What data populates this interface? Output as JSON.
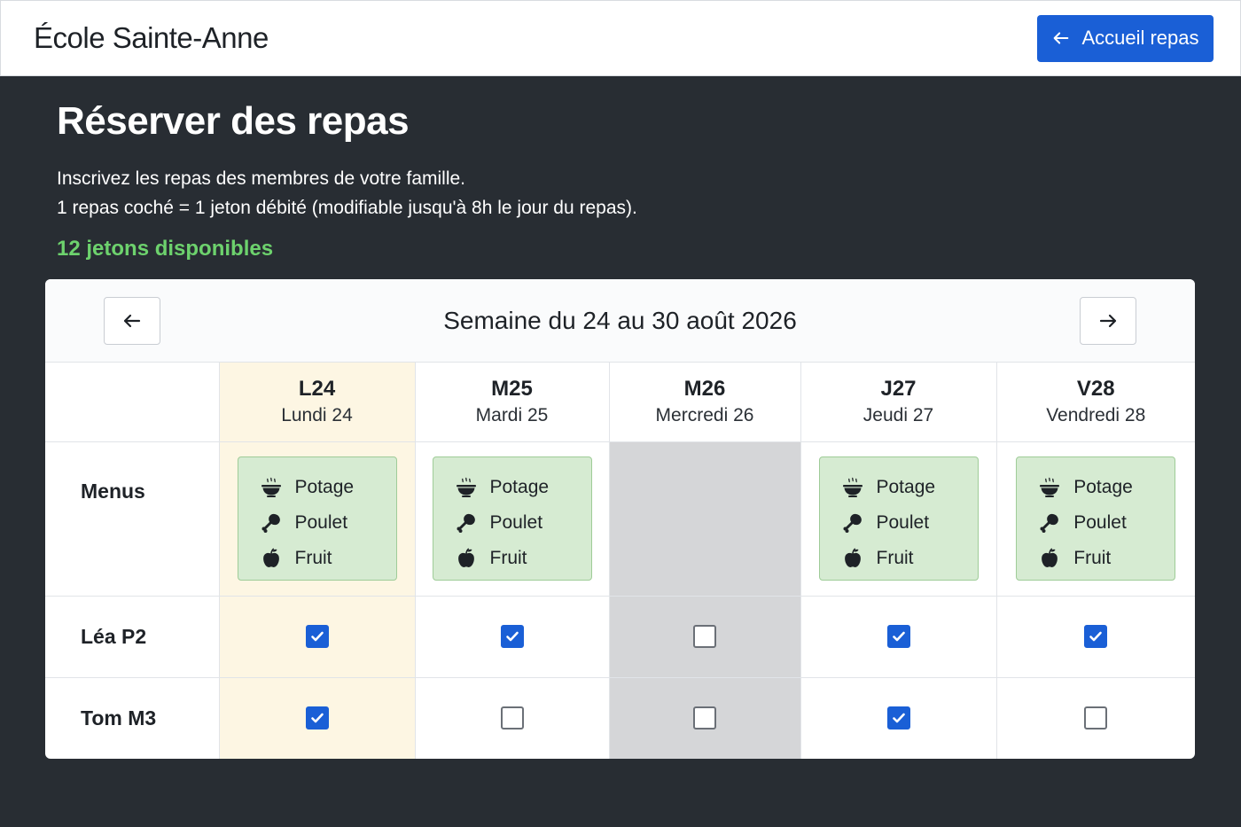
{
  "header": {
    "school": "École Sainte-Anne",
    "home_button": "Accueil repas"
  },
  "page": {
    "title": "Réserver des repas",
    "desc_line1": "Inscrivez les repas des membres de votre famille.",
    "desc_line2": "1 repas coché = 1 jeton débité (modifiable jusqu'à 8h le jour du repas).",
    "tokens": "12 jetons disponibles"
  },
  "week": {
    "label": "Semaine du 24 au 30 août 2026"
  },
  "days": [
    {
      "code": "L24",
      "name": "Lundi 24"
    },
    {
      "code": "M25",
      "name": "Mardi 25"
    },
    {
      "code": "M26",
      "name": "Mercredi 26"
    },
    {
      "code": "J27",
      "name": "Jeudi 27"
    },
    {
      "code": "V28",
      "name": "Vendredi 28"
    }
  ],
  "menu": {
    "row_label": "Menus",
    "starter": "Potage",
    "main": "Poulet",
    "dessert": "Fruit"
  },
  "kids": [
    {
      "name": "Léa P2",
      "meals": [
        true,
        true,
        false,
        true,
        true
      ]
    },
    {
      "name": "Tom M3",
      "meals": [
        true,
        false,
        false,
        true,
        false
      ]
    }
  ],
  "colors": {
    "accent": "#1a5fd6",
    "tokens": "#6dd26d",
    "today": "#fdf6e3",
    "closed": "#d5d6d8",
    "menu": "#d6ebd2"
  }
}
